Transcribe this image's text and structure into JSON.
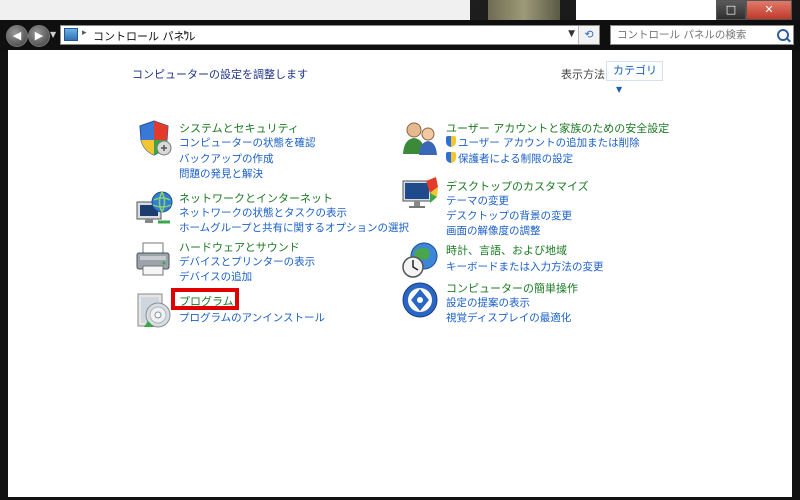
{
  "window": {
    "address_path": "コントロール パネル",
    "search_placeholder": "コントロール パネルの検索",
    "controls": {
      "restore": "□",
      "close": "✕"
    }
  },
  "header": {
    "heading": "コンピューターの設定を調整します",
    "view_by_label": "表示方法:",
    "view_by_value": "カテゴリ"
  },
  "categories": [
    {
      "title": "システムとセキュリティ",
      "icon": "shield-icon",
      "links": [
        "コンピューターの状態を確認",
        "バックアップの作成",
        "問題の発見と解決"
      ]
    },
    {
      "title": "ネットワークとインターネット",
      "icon": "network-globe-icon",
      "links": [
        "ネットワークの状態とタスクの表示",
        "ホームグループと共有に関するオプションの選択"
      ]
    },
    {
      "title": "ハードウェアとサウンド",
      "icon": "printer-icon",
      "links": [
        "デバイスとプリンターの表示",
        "デバイスの追加"
      ]
    },
    {
      "title": "プログラム",
      "icon": "programs-disc-icon",
      "links": [
        "プログラムのアンインストール"
      ],
      "highlight_color": "#e00000"
    },
    {
      "title": "ユーザー アカウントと家族のための安全設定",
      "icon": "user-accounts-icon",
      "links": [
        "ユーザー アカウントの追加または削除",
        "保護者による制限の設定"
      ]
    },
    {
      "title": "デスクトップのカスタマイズ",
      "icon": "desktop-customize-icon",
      "links": [
        "テーマの変更",
        "デスクトップの背景の変更",
        "画面の解像度の調整"
      ]
    },
    {
      "title": "時計、言語、および地域",
      "icon": "clock-globe-icon",
      "links": [
        "キーボードまたは入力方法の変更"
      ]
    },
    {
      "title": "コンピューターの簡単操作",
      "icon": "ease-of-access-icon",
      "links": [
        "設定の提案の表示",
        "視覚ディスプレイの最適化"
      ]
    }
  ],
  "colors": {
    "category_title": "#1a7a22",
    "link": "#1a5fc7",
    "heading": "#1e3287",
    "highlight": "#e00000"
  }
}
